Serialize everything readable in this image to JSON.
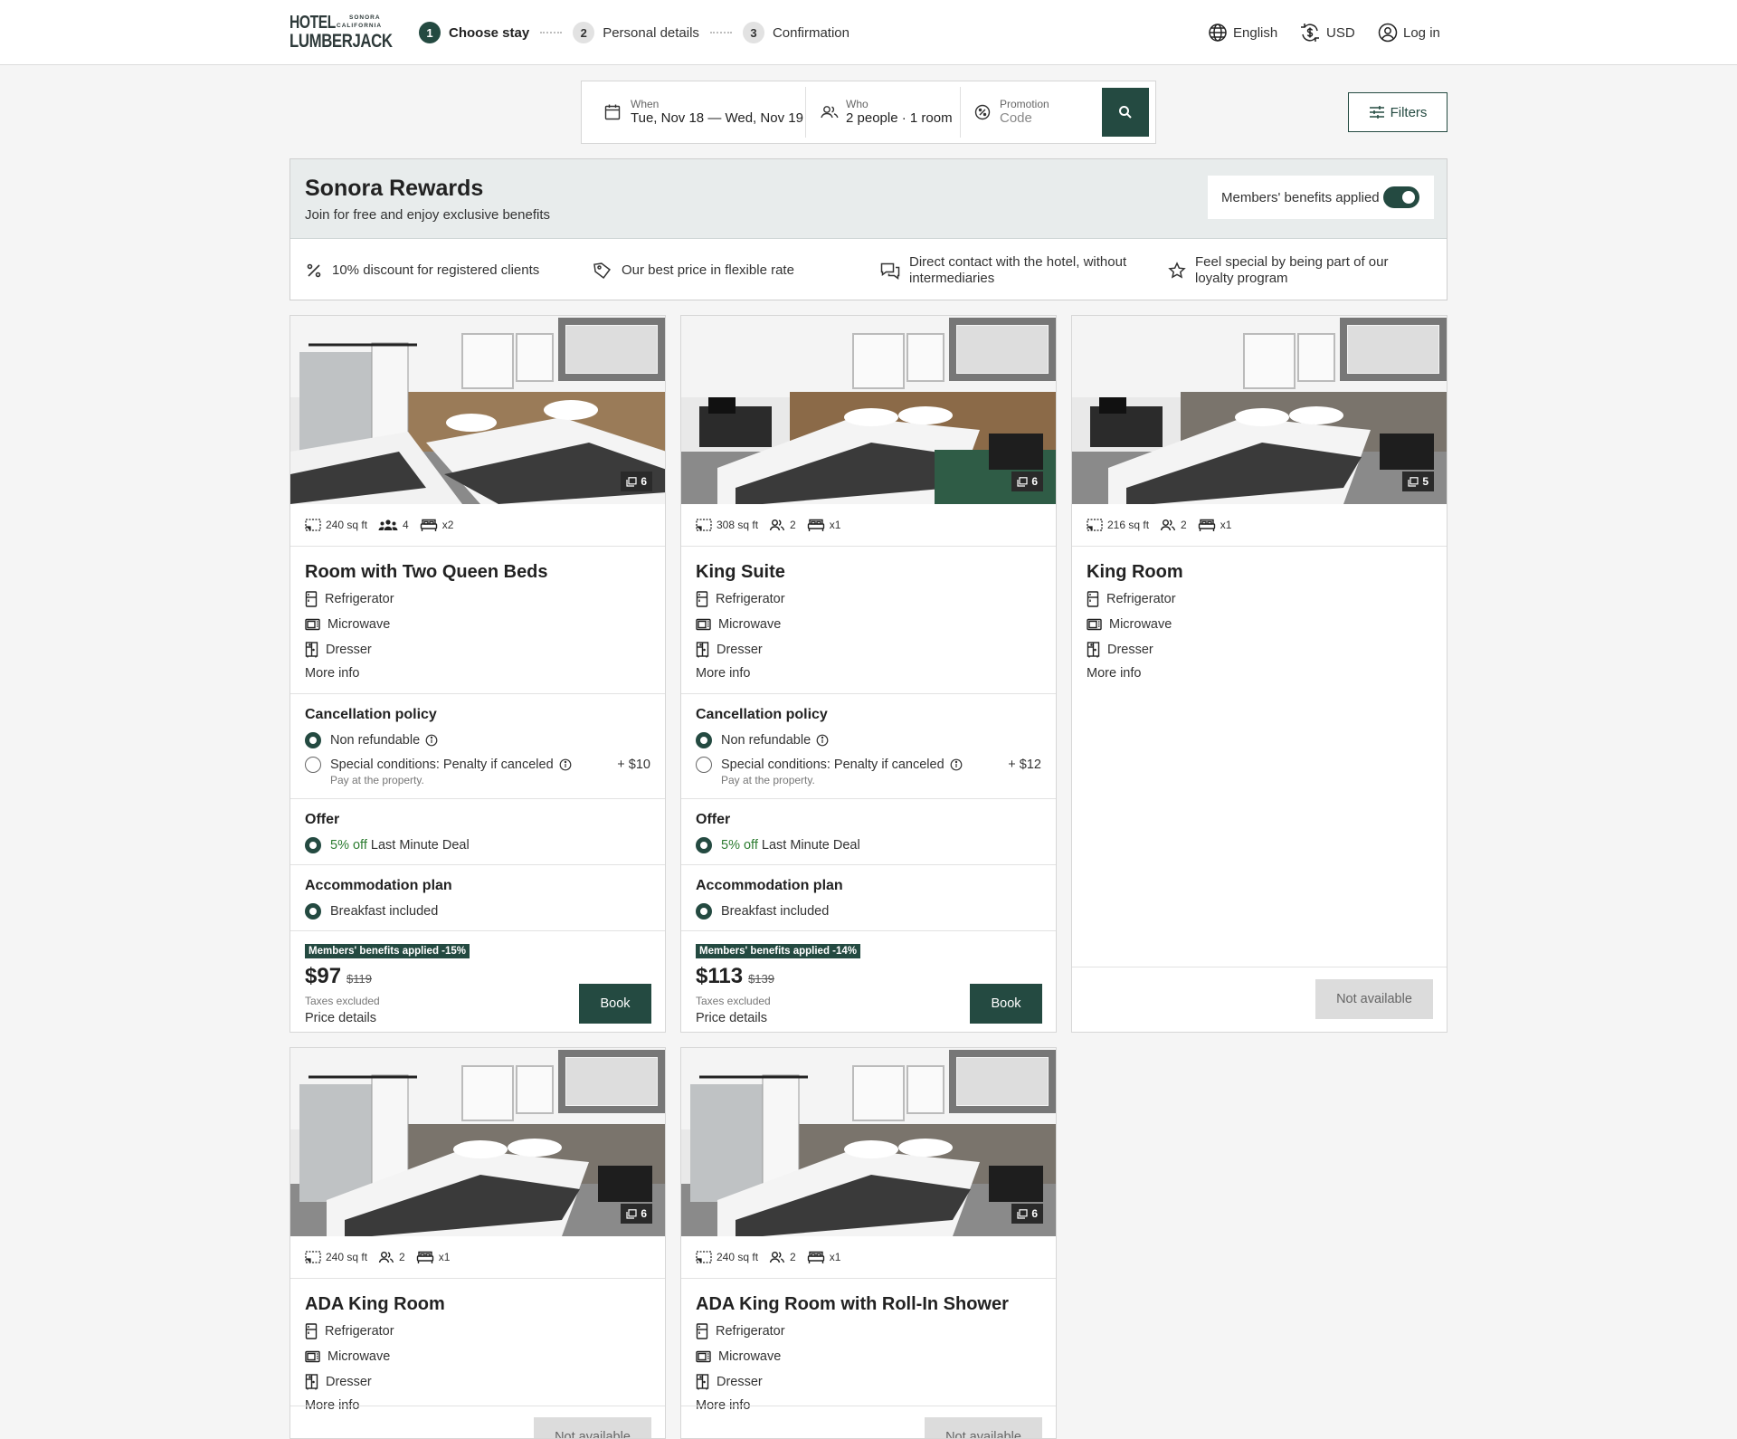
{
  "header": {
    "logo": {
      "line1": "HOTEL",
      "line2": "LUMBERJACK",
      "sub1": "SONORA",
      "sub2": "CALIFORNIA"
    },
    "steps": [
      {
        "num": "1",
        "label": "Choose stay",
        "active": true
      },
      {
        "num": "2",
        "label": "Personal details",
        "active": false
      },
      {
        "num": "3",
        "label": "Confirmation",
        "active": false
      }
    ],
    "language": "English",
    "currency": "USD",
    "login": "Log in"
  },
  "search": {
    "when_caption": "When",
    "when_value": "Tue, Nov 18 — Wed, Nov 19",
    "who_caption": "Who",
    "who_value": "2 people · 1 room",
    "promo_caption": "Promotion",
    "promo_placeholder": "Code",
    "filters_label": "Filters"
  },
  "rewards": {
    "title": "Sonora Rewards",
    "subtitle": "Join for free and enjoy exclusive benefits",
    "toggle_label": "Members' benefits applied",
    "toggle_on": true,
    "benefits": [
      {
        "icon": "percent-icon",
        "text": "10% discount for registered clients"
      },
      {
        "icon": "tag-icon",
        "text": "Our best price in flexible rate"
      },
      {
        "icon": "chat-icon",
        "text": "Direct contact with the hotel, without intermediaries"
      },
      {
        "icon": "star-icon",
        "text": "Feel special by being part of our loyalty program"
      }
    ]
  },
  "labels": {
    "amenities": [
      "Refrigerator",
      "Microwave",
      "Dresser"
    ],
    "more_info": "More info",
    "cancellation": "Cancellation policy",
    "non_refundable": "Non refundable",
    "special": "Special conditions: Penalty if canceled",
    "pay_note": "Pay at the property.",
    "offer": "Offer",
    "deal_pct": "5% off",
    "deal_name": "Last Minute Deal",
    "plan": "Accommodation plan",
    "breakfast": "Breakfast included",
    "taxes": "Taxes excluded",
    "price_details": "Price details",
    "book": "Book",
    "not_available": "Not available"
  },
  "rooms": [
    {
      "name": "Room with Two Queen Beds",
      "photos": "6",
      "size": "240 sq ft",
      "guests": "4",
      "beds": "x2",
      "available": true,
      "extra": "+ $10",
      "members_badge": "Members' benefits applied -15%",
      "price": "$97",
      "old_price": "$119",
      "beds_count": 2
    },
    {
      "name": "King Suite",
      "photos": "6",
      "size": "308 sq ft",
      "guests": "2",
      "beds": "x1",
      "available": true,
      "extra": "+ $12",
      "members_badge": "Members' benefits applied -14%",
      "price": "$113",
      "old_price": "$139",
      "beds_count": 1
    },
    {
      "name": "King Room",
      "photos": "5",
      "size": "216 sq ft",
      "guests": "2",
      "beds": "x1",
      "available": false,
      "beds_count": 1
    },
    {
      "name": "ADA King Room",
      "photos": "6",
      "size": "240 sq ft",
      "guests": "2",
      "beds": "x1",
      "available": false,
      "beds_count": 1
    },
    {
      "name": "ADA King Room with Roll-In Shower",
      "photos": "6",
      "size": "240 sq ft",
      "guests": "2",
      "beds": "x1",
      "available": false,
      "beds_count": 1
    }
  ],
  "colors": {
    "brand": "#244a41",
    "deal": "#2e7d32",
    "page_bg": "#f5f5f5"
  }
}
